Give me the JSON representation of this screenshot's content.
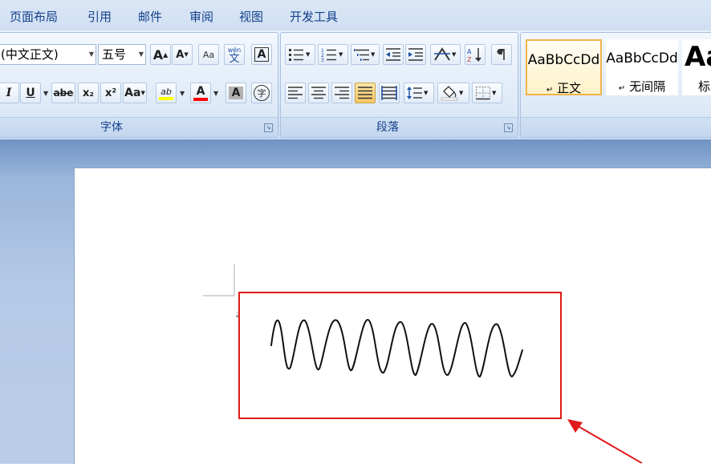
{
  "menu": [
    "页面布局",
    "引用",
    "邮件",
    "审阅",
    "视图",
    "开发工具"
  ],
  "font_group": {
    "label": "字体",
    "font_name": "(中文正文)",
    "font_size": "五号",
    "size_up": "A",
    "size_down": "A",
    "clear_format": "Aa",
    "phonetic_top": "wén",
    "phonetic_char": "文",
    "char_border": "A",
    "italic": "I",
    "underline": "U",
    "strike": "abe",
    "subscript": "x₂",
    "superscript": "x²",
    "change_case": "Aa",
    "highlight": "ab",
    "font_color": "A",
    "char_shading": "A",
    "enclose": "字"
  },
  "paragraph_group": {
    "label": "段落"
  },
  "styles": [
    {
      "sample": "AaBbCcDd",
      "name": "正文"
    },
    {
      "sample": "AaBbCcDd",
      "name": "无间隔"
    },
    {
      "sample": "Aa",
      "name": "标"
    }
  ],
  "colors": {
    "highlight_bar": "#ffff00",
    "font_color_bar": "#ff0000",
    "annotation_red": "#e0191b",
    "active_style_border": "#f0b44c"
  }
}
